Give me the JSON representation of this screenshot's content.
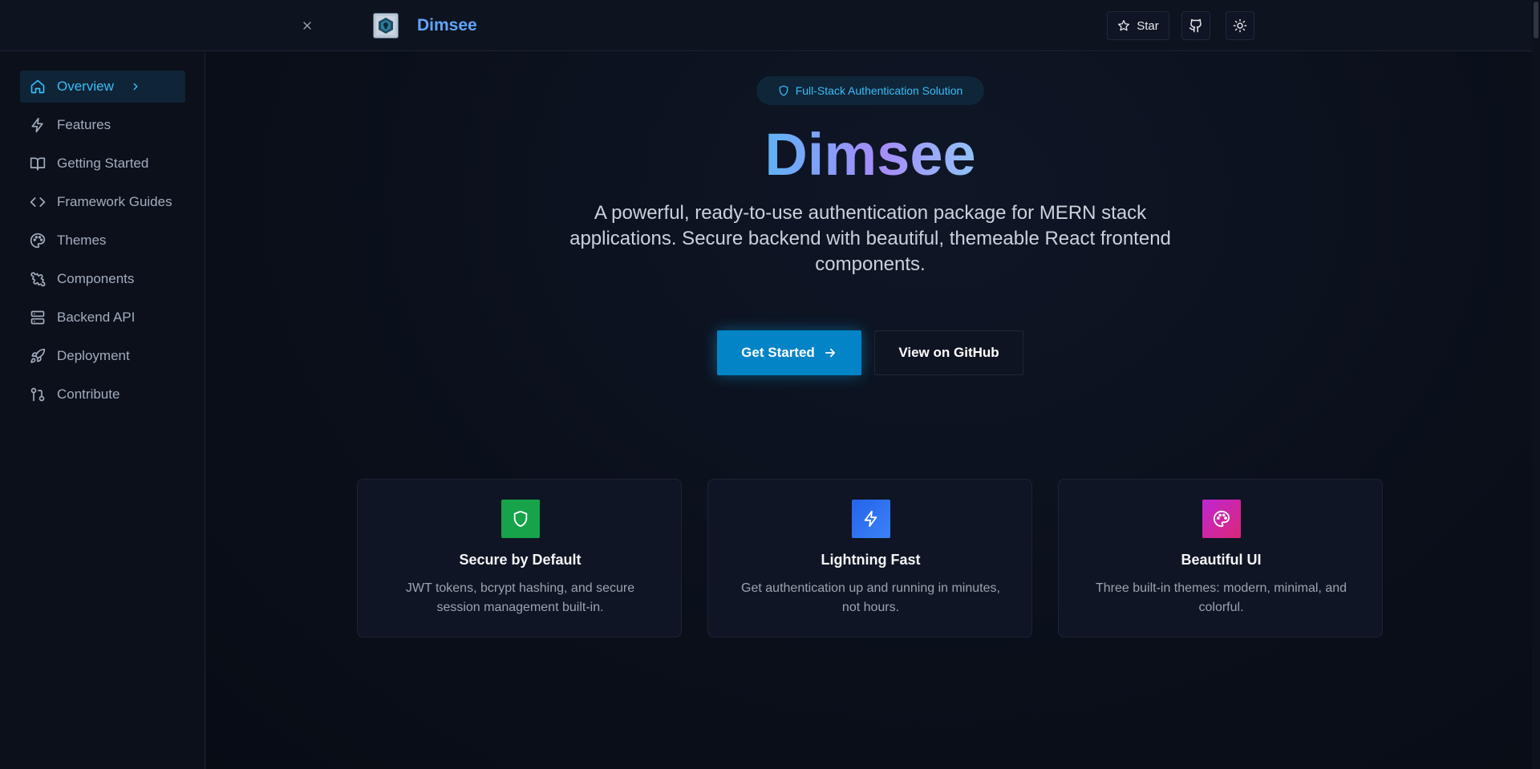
{
  "header": {
    "brand": "Dimsee",
    "star_label": "Star",
    "icons": [
      "close-icon",
      "logo",
      "star-icon",
      "github-icon",
      "sun-icon"
    ]
  },
  "sidebar": {
    "items": [
      {
        "label": "Overview",
        "icon": "home-icon",
        "active": true
      },
      {
        "label": "Features",
        "icon": "zap-icon"
      },
      {
        "label": "Getting Started",
        "icon": "book-icon"
      },
      {
        "label": "Framework Guides",
        "icon": "code-icon"
      },
      {
        "label": "Themes",
        "icon": "palette-icon"
      },
      {
        "label": "Components",
        "icon": "puzzle-icon"
      },
      {
        "label": "Backend API",
        "icon": "server-icon"
      },
      {
        "label": "Deployment",
        "icon": "rocket-icon"
      },
      {
        "label": "Contribute",
        "icon": "git-pull-request-icon"
      }
    ]
  },
  "hero": {
    "badge": "Full-Stack Authentication Solution",
    "title": "Dimsee",
    "description": "A powerful, ready-to-use authentication package for MERN stack applications. Secure backend with beautiful, themeable React frontend components.",
    "primary_button": "Get Started",
    "secondary_button": "View on GitHub"
  },
  "features": [
    {
      "title": "Secure by Default",
      "text": "JWT tokens, bcrypt hashing, and secure session management built-in.",
      "icon": "shield-icon",
      "color": "#16a34a"
    },
    {
      "title": "Lightning Fast",
      "text": "Get authentication up and running in minutes, not hours.",
      "icon": "zap-icon",
      "color": "#2563eb"
    },
    {
      "title": "Beautiful UI",
      "text": "Three built-in themes: modern, minimal, and colorful.",
      "icon": "palette-icon",
      "color": "#c026d3"
    }
  ],
  "colors": {
    "accent": "#38bdf8",
    "primary_button": "#0284c7",
    "background": "#0a0f1a"
  }
}
